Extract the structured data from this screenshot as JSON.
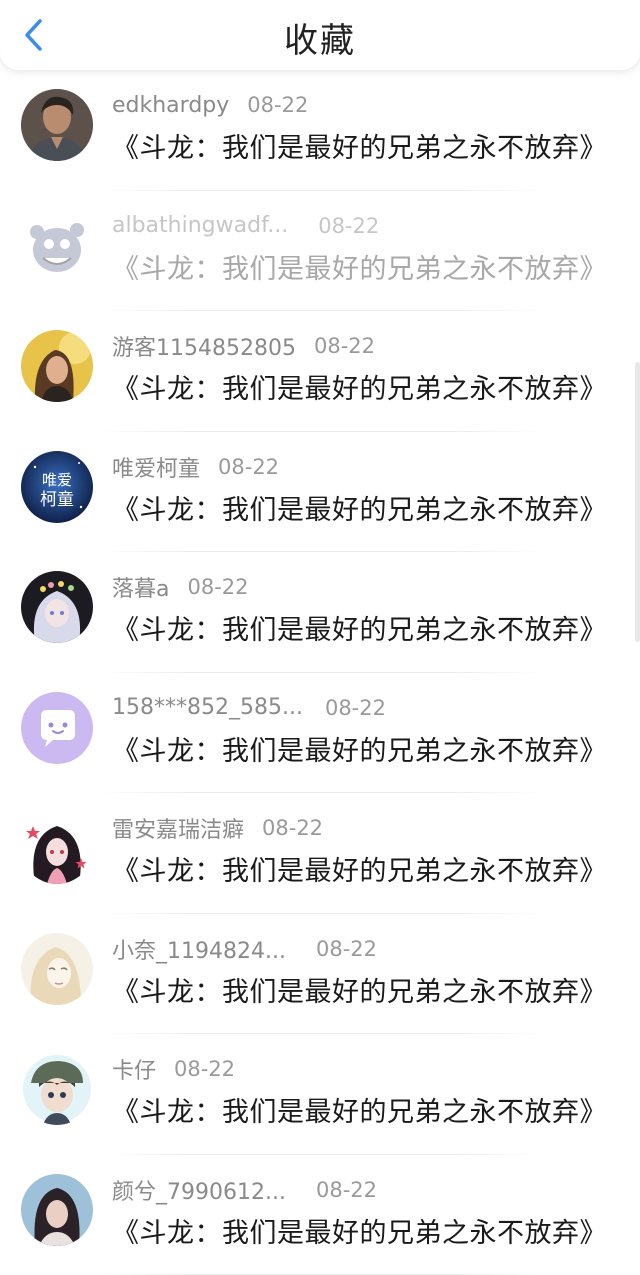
{
  "header": {
    "title": "收藏",
    "back_icon": "chevron-left-icon",
    "accent_color": "#3e8ee8"
  },
  "items": [
    {
      "user": "edkhardpy",
      "date": "08-22",
      "content": "《斗龙：我们是最好的兄弟之永不放弃》",
      "avatar": "avatar-man-photo"
    },
    {
      "user": "albathingwadf...",
      "date": "08-22",
      "content": "《斗龙：我们是最好的兄弟之永不放弃》",
      "avatar": "avatar-cartoon-monster"
    },
    {
      "user": "游客1154852805",
      "date": "08-22",
      "content": "《斗龙：我们是最好的兄弟之永不放弃》",
      "avatar": "avatar-girl-golden"
    },
    {
      "user": "唯爱柯童",
      "date": "08-22",
      "content": "《斗龙：我们是最好的兄弟之永不放弃》",
      "avatar": "avatar-text-logo",
      "avatar_text": "唯爱柯童"
    },
    {
      "user": "落暮a",
      "date": "08-22",
      "content": "《斗龙：我们是最好的兄弟之永不放弃》",
      "avatar": "avatar-anime-flower"
    },
    {
      "user": "158***852_585...",
      "date": "08-22",
      "content": "《斗龙：我们是最好的兄弟之永不放弃》",
      "avatar": "avatar-chat-bubble"
    },
    {
      "user": "雷安嘉瑞洁癖",
      "date": "08-22",
      "content": "《斗龙：我们是最好的兄弟之永不放弃》",
      "avatar": "avatar-anime-stars"
    },
    {
      "user": "小奈_1194824...",
      "date": "08-22",
      "content": "《斗龙：我们是最好的兄弟之永不放弃》",
      "avatar": "avatar-anime-sketch"
    },
    {
      "user": "卡仔",
      "date": "08-22",
      "content": "《斗龙：我们是最好的兄弟之永不放弃》",
      "avatar": "avatar-anime-boy-hat"
    },
    {
      "user": "颜兮_7990612...",
      "date": "08-22",
      "content": "《斗龙：我们是最好的兄弟之永不放弃》",
      "avatar": "avatar-girl-photo"
    }
  ]
}
